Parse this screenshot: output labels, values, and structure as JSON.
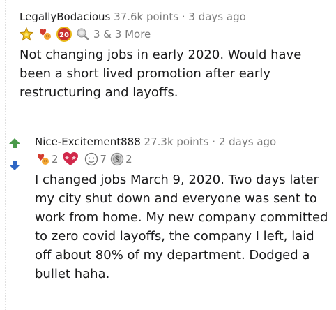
{
  "comments": [
    {
      "author": "LegallyBodacious",
      "points": "37.6k points",
      "separator": "·",
      "time": "3 days ago",
      "award_badge": "20",
      "awards_more": "3 & 3 More",
      "body": "Not changing jobs in early 2020. Would have been a short lived promotion after early restructuring and layoffs."
    },
    {
      "author": "Nice-Excitement888",
      "points": "27.3k points",
      "separator": "·",
      "time": "2 days ago",
      "awards": [
        {
          "icon": "wholesome-icon",
          "count": "2"
        },
        {
          "icon": "heart-eyes-icon",
          "count": ""
        },
        {
          "icon": "face-icon",
          "count": "7"
        },
        {
          "icon": "silver-coin-icon",
          "count": "2"
        }
      ],
      "body": "I changed jobs March 9, 2020. Two days later my city shut down and everyone was sent to work from home. My new company committed to zero covid layoffs, the company I left, laid off about 80% of my department. Dodged a bullet haha."
    }
  ],
  "colors": {
    "upvote": "#4a9a4a",
    "downvote": "#2f66c4",
    "meta_gray": "#7c7c7c",
    "award_red": "#c8312f",
    "award_gold": "#e8b818"
  }
}
